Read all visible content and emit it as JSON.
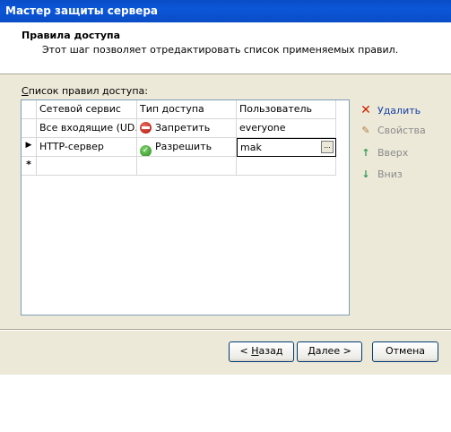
{
  "window": {
    "title": "Мастер защиты сервера"
  },
  "header": {
    "title": "Правила доступа",
    "description": "Этот шаг позволяет отредактировать список применяемых правил."
  },
  "list": {
    "label": "Список правил доступа:",
    "columns": [
      "Сетевой сервис",
      "Тип доступа",
      "Пользователь"
    ],
    "rows": [
      {
        "service": "Все входящие (UD...",
        "access": "Запретить",
        "access_icon": "deny-icon",
        "user": "everyone"
      },
      {
        "service": "HTTP-сервер",
        "access": "Разрешить",
        "access_icon": "allow-icon",
        "user": "mak"
      }
    ],
    "row_marker_current": "▶",
    "row_marker_new": "*"
  },
  "actions": {
    "delete": "Удалить",
    "properties": "Свойства",
    "up": "Вверх",
    "down": "Вниз"
  },
  "buttons": {
    "back_prefix": "< ",
    "back_key": "Н",
    "back_rest": "азад",
    "next_key": "Д",
    "next_rest": "алее >",
    "cancel": "Отмена"
  },
  "colors": {
    "titlebar": "#0a4cc6",
    "delete_icon": "#cc2200",
    "arrow_icon": "#2e9e57"
  }
}
